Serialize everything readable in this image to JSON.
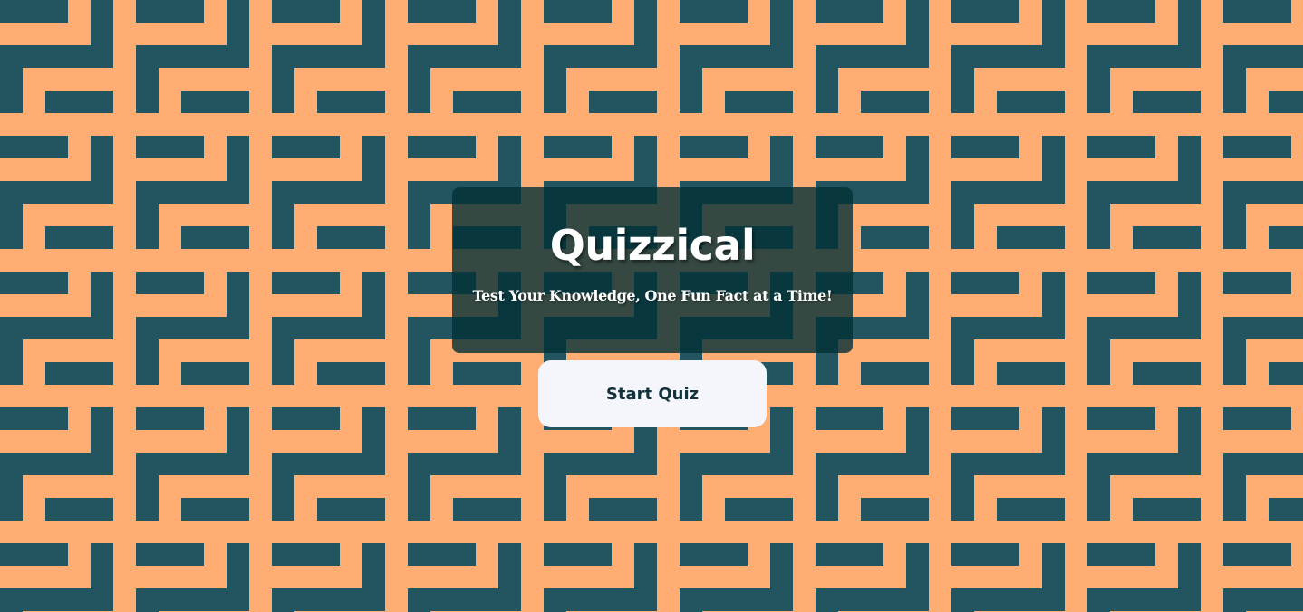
{
  "app": {
    "title": "Quizzical",
    "tagline": "Test Your Knowledge, One Fun Fact at a Time!"
  },
  "actions": {
    "start_label": "Start Quiz"
  },
  "colors": {
    "background_orange": "#ffad73",
    "pattern_teal": "#22555f",
    "card_overlay": "#032f36",
    "button_bg": "#f4f6fb",
    "button_text": "#13323c"
  }
}
